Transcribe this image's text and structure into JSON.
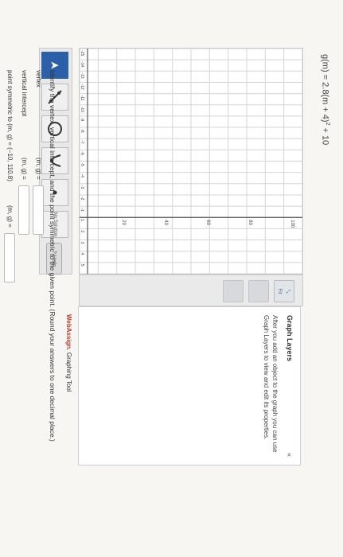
{
  "equation": {
    "lhs": "g(m) = 2.8(m + 4)",
    "exp": "2",
    "rhs": " + 10"
  },
  "toolbar": {
    "tools": [
      {
        "name": "pointer-tool",
        "glyph": "➤"
      },
      {
        "name": "line-tool",
        "glyph": "⤢"
      },
      {
        "name": "circle-tool",
        "glyph": "○"
      },
      {
        "name": "parabola-tool",
        "glyph": "∪"
      },
      {
        "name": "point-tool",
        "glyph": "•"
      },
      {
        "name": "no-solution-tool",
        "glyph": "No Solution"
      }
    ],
    "help_label": "Help"
  },
  "graph": {
    "y_labels": [
      "100",
      "80",
      "60",
      "40",
      "20"
    ],
    "x_labels": [
      "-15",
      "-14",
      "-13",
      "-12",
      "-11",
      "-10",
      "-9",
      "-8",
      "-7",
      "-6",
      "-5",
      "-4",
      "-3",
      "-2",
      "-1",
      "1",
      "2",
      "3",
      "4",
      "5"
    ],
    "fit_label": "Fit",
    "brand_web": "Web",
    "brand_assign": "Assign",
    "brand_rest": ". Graphing Tool"
  },
  "layers": {
    "title": "Graph Layers",
    "collapse": "«",
    "body": "After you add an object to the graph you can use Graph Layers to view and edit its properties."
  },
  "question": {
    "instruction": "Identify the vertex, vertical intercept, and the point symmetric to the given point. (Round your answers to one decimal place.)",
    "rows": [
      {
        "label": "vertex",
        "prompt": "(m, g) ="
      },
      {
        "label": "vertical intercept",
        "prompt": "(m, g) ="
      },
      {
        "label": "point symmetric to (m, g) = (−10, 110.8)",
        "prompt": "(m, g) ="
      }
    ]
  }
}
